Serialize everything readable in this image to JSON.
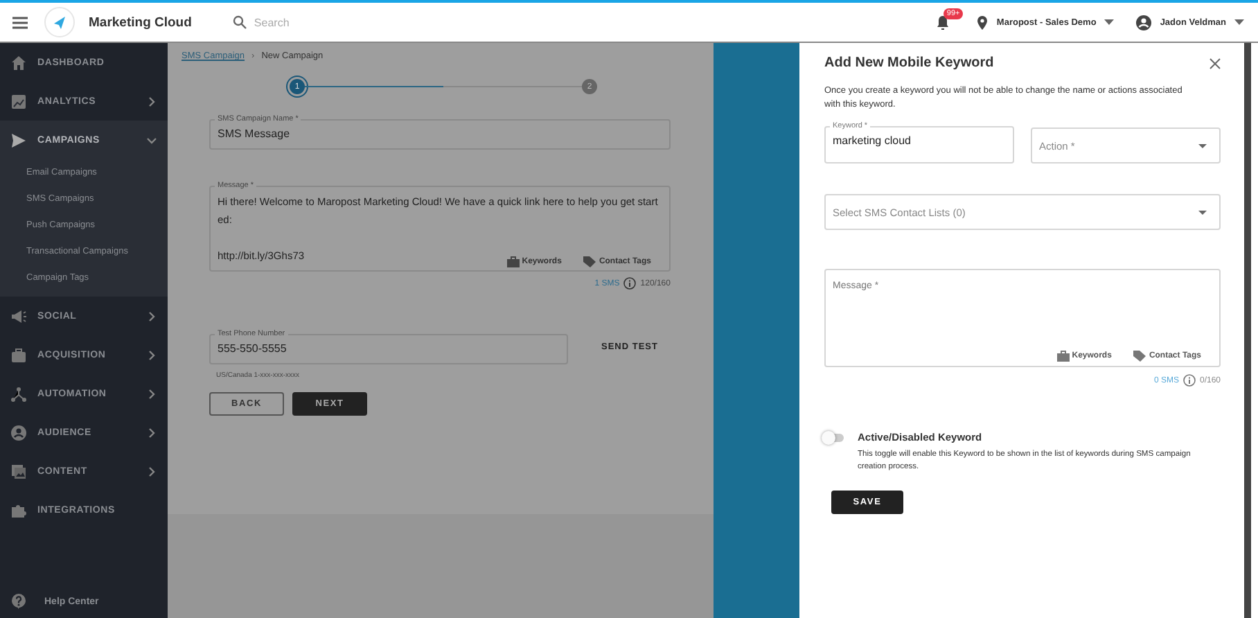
{
  "topbar": {
    "app_name": "Marketing Cloud",
    "search": {
      "placeholder": "Search"
    },
    "notification_badge": "99+",
    "account": "Maropost - Sales Demo",
    "user": "Jadon Veldman"
  },
  "sidebar": {
    "items": [
      {
        "label": "DASHBOARD",
        "kind": "link",
        "selected": false
      },
      {
        "label": "ANALYTICS",
        "kind": "group",
        "expanded": false,
        "selected": false
      },
      {
        "label": "CAMPAIGNS",
        "kind": "group",
        "expanded": true,
        "selected": true,
        "children": [
          {
            "label": "Email Campaigns"
          },
          {
            "label": "SMS Campaigns"
          },
          {
            "label": "Push Campaigns"
          },
          {
            "label": "Transactional Campaigns"
          },
          {
            "label": "Campaign Tags"
          }
        ]
      },
      {
        "label": "SOCIAL",
        "kind": "group",
        "expanded": false,
        "selected": false
      },
      {
        "label": "ACQUISITION",
        "kind": "group",
        "expanded": false,
        "selected": false
      },
      {
        "label": "AUTOMATION",
        "kind": "group",
        "expanded": false,
        "selected": false
      },
      {
        "label": "AUDIENCE",
        "kind": "group",
        "expanded": false,
        "selected": false
      },
      {
        "label": "CONTENT",
        "kind": "group",
        "expanded": false,
        "selected": false
      },
      {
        "label": "INTEGRATIONS",
        "kind": "link",
        "selected": false
      }
    ],
    "help": "Help Center"
  },
  "main": {
    "breadcrumb": {
      "link": "SMS Campaign",
      "separator": "›",
      "current": "New Campaign"
    },
    "steps": [
      {
        "label": "1",
        "selected": true
      },
      {
        "label": "2",
        "selected": false
      }
    ],
    "campaign_name": {
      "label": "SMS Campaign Name *",
      "value": "SMS Message"
    },
    "message": {
      "label": "Message *",
      "value": "Hi there! Welcome to Maropost Marketing Cloud! We have a quick link here to help you get start\ned:\n\nhttp://bit.ly/3Ghs73",
      "keywords": "Keywords",
      "contact_tags": "Contact Tags",
      "sms_count": "1 SMS",
      "char_count": "120/160"
    },
    "phone": {
      "label": "Test Phone Number",
      "value": "555-550-5555",
      "hint": "US/Canada 1-xxx-xxx-xxxx"
    },
    "send_test": "SEND TEST",
    "back": "BACK",
    "next": "NEXT"
  },
  "drawer": {
    "title": "Add New Mobile Keyword",
    "description": "Once you create a keyword you will not be able to change the name or actions associated with this keyword.",
    "keyword": {
      "label": "Keyword *",
      "value": "marketing cloud"
    },
    "action": {
      "placeholder": "Action *"
    },
    "contact_lists": {
      "placeholder": "Select SMS Contact Lists (0)"
    },
    "message": {
      "placeholder": "Message *",
      "keywords": "Keywords",
      "contact_tags": "Contact Tags",
      "sms_count": "0 SMS",
      "char_count": "0/160"
    },
    "toggle": {
      "label": "Active/Disabled Keyword",
      "on": false,
      "description": "This toggle will enable this Keyword to be shown in the list of keywords during SMS campaign creation process."
    },
    "save": "SAVE"
  }
}
